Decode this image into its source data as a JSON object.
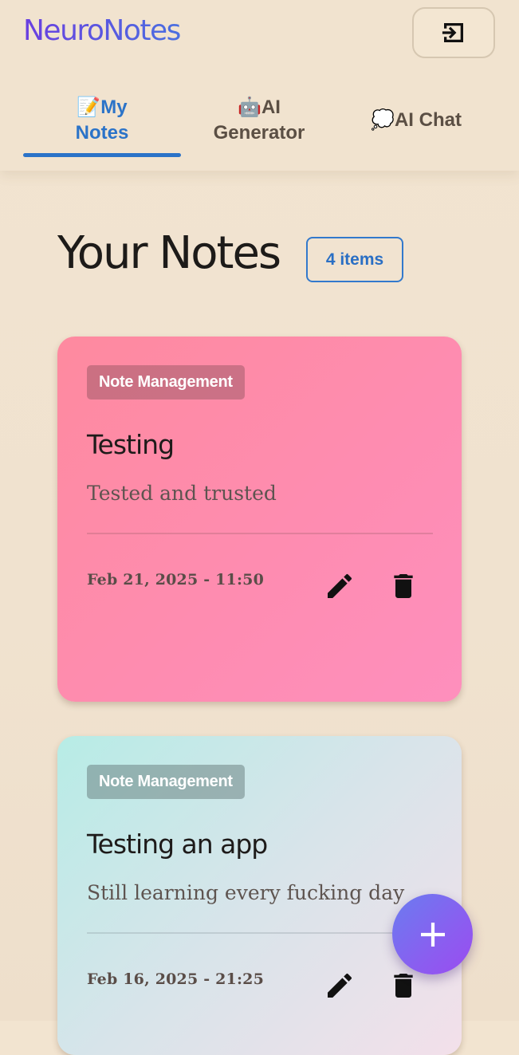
{
  "app": {
    "title": "NeuroNotes",
    "logout_icon": "logout-icon"
  },
  "tabs": [
    {
      "emoji": "📝",
      "label_line1": "My",
      "label_line2": "Notes",
      "active": true
    },
    {
      "emoji": "🤖",
      "label_line1": "AI",
      "label_line2": "Generator",
      "active": false
    },
    {
      "emoji": "💭",
      "label_line1": "AI Chat",
      "label_line2": "",
      "active": false
    }
  ],
  "page": {
    "title": "Your Notes",
    "count_badge": "4 items"
  },
  "notes": [
    {
      "tag": "Note Management",
      "title": "Testing",
      "body": "Tested and trusted",
      "date": "Feb 21, 2025 - 11:50",
      "edit_icon": "pencil-icon",
      "delete_icon": "trash-icon"
    },
    {
      "tag": "Note Management",
      "title": "Testing an app",
      "body": "Still learning every fucking day",
      "date": "Feb 16, 2025 - 21:25",
      "edit_icon": "pencil-icon",
      "delete_icon": "trash-icon"
    }
  ],
  "fab": {
    "icon": "plus-icon"
  },
  "colors": {
    "brand_start": "#6a3fe0",
    "brand_end": "#4a6fe0",
    "active_tab": "#2b73c8",
    "background": "#f1e3cf",
    "card_pink": "#fe8aa6",
    "card_mint": "#c8e8e6"
  }
}
